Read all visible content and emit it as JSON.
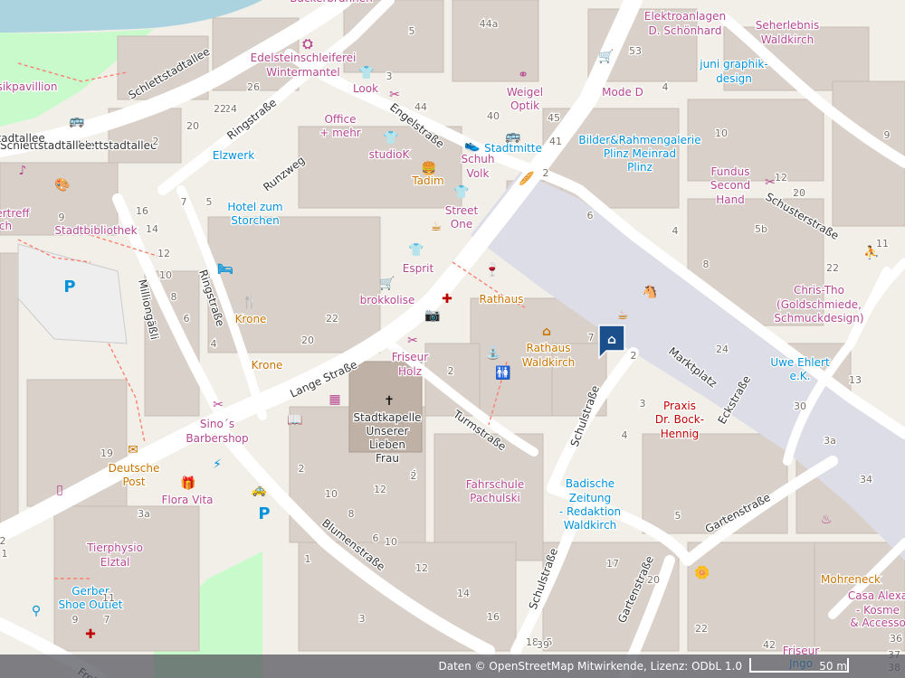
{
  "map": {
    "colors": {
      "background": "#f2efe9",
      "building": "#d9d0c9",
      "road": "#ffffff",
      "pedestrian": "#dddde8",
      "water": "#aad3df",
      "park": "#c8facc",
      "amenity": "#b5478f",
      "food": "#c77400",
      "blue": "#0092da",
      "health": "#bf0000"
    },
    "streets": [
      "Schlettstadtallee",
      "Schlettstadtallee",
      "Schlettstadtallee",
      "Ringstraße",
      "Runzweg",
      "Engelstraße",
      "Ringstraße",
      "Milliongäßli",
      "Lange Straße",
      "Turmstraße",
      "Schulstraße",
      "Schulstraße",
      "Gartenstraße",
      "Gartenstraße",
      "Blumenstraße",
      "Marktplatz",
      "Eckstraße",
      "Schusterstraße",
      "Frein"
    ],
    "poi_labels": [
      "Bäckerbrunnen",
      "Elektroanlagen",
      "D. Schönhard",
      "Seherlebnis",
      "Waldkirch",
      "Edelsteinschleiferei",
      "Wintermantel",
      "juni graphik-",
      "design",
      "Look",
      "Weigel",
      "Optik",
      "Mode D",
      "Office",
      "+ mehr",
      "Elzwerk",
      "Bilder&Rahmengalerie",
      "Plinz Meinrad",
      "Plinz",
      "studioK",
      "Stadtmitte",
      "Schuh",
      "Volk",
      "Fundus",
      "Second",
      "Hand",
      "Tadim",
      "Hotel zum",
      "Storchen",
      "Street",
      "One",
      "Stadtbibliothek",
      "Esprit",
      "Chris-Tho",
      "(Goldschmiede,",
      "Schmuckdesign)",
      "brokkolise",
      "Rathaus",
      "Krone",
      "Krone",
      "Rathaus",
      "Waldkirch",
      "Uwe Ehlert",
      "e.K.",
      "Friseur",
      "Holz",
      "Praxis",
      "Dr. Bock-",
      "Hennig",
      "Stadtkapelle",
      "Unserer",
      "Lieben",
      "Frau",
      "Sino´s",
      "Barbershop",
      "Deutsche",
      "Post",
      "Fahrschule",
      "Pachulski",
      "Badische",
      "Zeitung",
      "- Redaktion",
      "Waldkirch",
      "Flora Vita",
      "Tierphysio",
      "Elztal",
      "Gerber",
      "Shoe Outlet",
      "Mohreneck",
      "Casa Alexa",
      "- Kosme",
      "& Accesso",
      "Friseur",
      "Jngo",
      "sikpavillion",
      "stadtallee",
      "ertreff",
      "ch"
    ],
    "house_numbers": [
      "44a",
      "5",
      "53",
      "4",
      "44",
      "3",
      "26",
      "24",
      "22",
      "20",
      "2",
      "7",
      "5",
      "16",
      "14",
      "12",
      "10",
      "8",
      "6",
      "4",
      "9",
      "40",
      "45",
      "41",
      "2",
      "6",
      "8",
      "10",
      "12",
      "14",
      "4",
      "22",
      "20",
      "7",
      "2",
      "9",
      "11",
      "5b",
      "20",
      "22",
      "24",
      "13",
      "30",
      "3a",
      "34",
      "2",
      "12",
      "10",
      "8",
      "6",
      "4",
      "2",
      "3a",
      "19",
      "10",
      "12",
      "14",
      "16",
      "18",
      "1",
      "3",
      "5",
      "17",
      "20",
      "22",
      "5",
      "4",
      "3",
      "2",
      "2",
      "1",
      "36",
      "37",
      "38",
      "7",
      "9",
      "11",
      "39",
      "42"
    ],
    "icons": [
      "jewelry-icon",
      "clothes-icon",
      "hairdresser-icon",
      "clothes-icon",
      "shoe-icon",
      "fast-food-icon",
      "clothes-icon",
      "cafe-icon",
      "clothes-icon",
      "shopping-cart-icon",
      "pharmacy-icon",
      "camera-icon",
      "hairdresser-icon",
      "restaurant-icon",
      "drinking-water-icon",
      "picnic-icon",
      "townhall-icon",
      "cafe-icon",
      "toilets-icon",
      "hairdresser-icon",
      "library-icon",
      "newspaper-icon",
      "post-office-icon",
      "gift-icon",
      "charging-icon",
      "taxi-icon",
      "parking-icon",
      "parking-icon",
      "hospital-icon",
      "church-icon",
      "bus-stop-icon",
      "bus-stop-icon",
      "florist-icon",
      "playground-icon",
      "arts-icon",
      "music-icon",
      "mobile-phone-icon",
      "optician-icon",
      "shopping-cart-icon",
      "furniture-icon",
      "toys-icon",
      "bakery-icon",
      "hotel-icon",
      "post-box-icon",
      "fire-icon",
      "home-marker-icon"
    ]
  },
  "attribution": {
    "text": "Daten © OpenStreetMap Mitwirkende, Lizenz: ODbL 1.0",
    "scale_label": "50 m"
  }
}
